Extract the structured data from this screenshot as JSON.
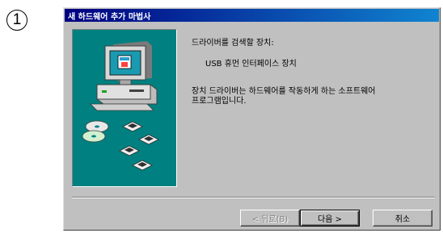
{
  "step": {
    "number": "1"
  },
  "window": {
    "title": "새 하드웨어 추가 마법사"
  },
  "content": {
    "searching_label": "드라이버를 검색할 장치:",
    "device_name": "USB 휴먼 인터페이스 장치",
    "description_line1": "장치 드라이버는 하드웨어를 작동하게 하는 소프트웨어",
    "description_line2": "프로그램입니다."
  },
  "buttons": {
    "back": "< 뒤로(B)",
    "next": "다음 >",
    "cancel": "취소"
  },
  "colors": {
    "titlebar_start": "#000080",
    "titlebar_end": "#1084d0",
    "art_background": "#008080",
    "dialog": "#c0c0c0"
  },
  "icons": [
    "computer-icon",
    "cd-icon",
    "floppy-disk-icon"
  ]
}
